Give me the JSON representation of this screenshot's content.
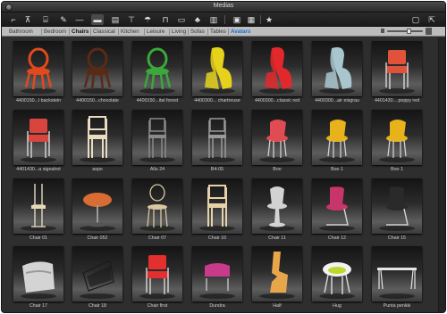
{
  "window": {
    "title": "Medias"
  },
  "toolbar": {
    "icons": [
      "tool-icon",
      "chair-tool-icon",
      "stairs-icon",
      "brush-icon",
      "line-icon",
      "sofa-icon",
      "document-icon",
      "lamp-icon",
      "umbrella-icon",
      "table-icon",
      "car-icon",
      "plant-icon",
      "building-icon",
      "display-icon",
      "image-icon",
      "star-icon",
      "folder-icon",
      "export-icon"
    ]
  },
  "tabs": [
    {
      "label": "Bathroom"
    },
    {
      "label": "Bedroom"
    },
    {
      "label": "Chairs"
    },
    {
      "label": "Classical"
    },
    {
      "label": "Kitchen"
    },
    {
      "label": "Leisure"
    },
    {
      "label": "Living"
    },
    {
      "label": "Sofas"
    },
    {
      "label": "Tables"
    },
    {
      "label": "Avatars"
    }
  ],
  "items": [
    {
      "caption": "4400150...l backstein",
      "color": "#e24a1c"
    },
    {
      "caption": "4400150...chocolate",
      "color": "#5a2a16"
    },
    {
      "caption": "4400150...ital forest",
      "color": "#3aa83a"
    },
    {
      "caption": "4400300... chartreuse",
      "color": "#e6d21a"
    },
    {
      "caption": "4400300...classic red",
      "color": "#e3282c"
    },
    {
      "caption": "4400300...air eisgrau",
      "color": "#a9c6cf"
    },
    {
      "caption": "4401430....poppy red",
      "color": "#e0533a"
    },
    {
      "caption": "4401430...a signalrot",
      "color": "#d8453e"
    },
    {
      "caption": "aspo",
      "color": "#e9dcc0"
    },
    {
      "caption": "Allu 24",
      "color": "#8a8a8a"
    },
    {
      "caption": "B4-05",
      "color": "#9a9a9a"
    },
    {
      "caption": "Boo",
      "color": "#e14b52"
    },
    {
      "caption": "Boo 1",
      "color": "#e8b21a"
    },
    {
      "caption": "Boo 1",
      "color": "#e8b21a"
    },
    {
      "caption": "Chair 01",
      "color": "#e8d8b6"
    },
    {
      "caption": "Chair 052",
      "color": "#d86d33"
    },
    {
      "caption": "Chair 07",
      "color": "#d8c8a2"
    },
    {
      "caption": "Chair 10",
      "color": "#e6d2a8"
    },
    {
      "caption": "Chair 11",
      "color": "#d2d2d2"
    },
    {
      "caption": "Chair 12",
      "color": "#c8356a"
    },
    {
      "caption": "Chair 15",
      "color": "#2a2a2a"
    },
    {
      "caption": "Chair 17",
      "color": "#d4d4d4"
    },
    {
      "caption": "Chair 18",
      "color": "#1c1c1c"
    },
    {
      "caption": "Chair first",
      "color": "#e3302e"
    },
    {
      "caption": "Dundra",
      "color": "#c83a8a"
    },
    {
      "caption": "Half",
      "color": "#e8a64a"
    },
    {
      "caption": "Hug",
      "color": "#bfd830"
    },
    {
      "caption": "Punta penkki",
      "color": "#e6e6e6"
    }
  ]
}
